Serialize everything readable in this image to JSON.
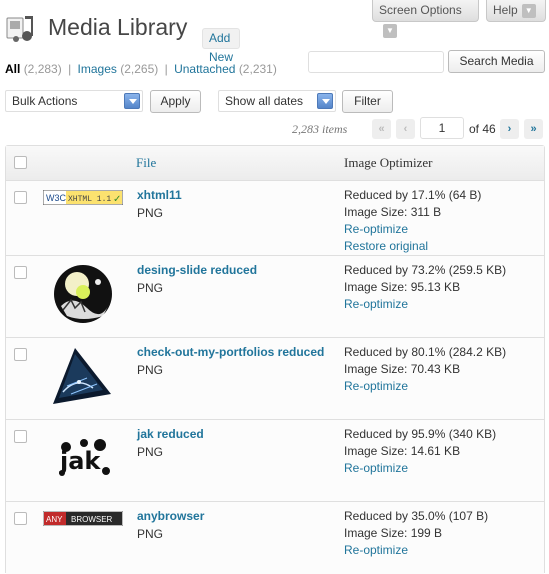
{
  "top_buttons": {
    "screen_options": "Screen Options",
    "help": "Help"
  },
  "header": {
    "title": "Media Library",
    "add_new": "Add New"
  },
  "filters": {
    "all": {
      "label": "All",
      "count": "(2,283)"
    },
    "images": {
      "label": "Images",
      "count": "(2,265)"
    },
    "unattached": {
      "label": "Unattached",
      "count": "(2,231)"
    },
    "separator": "|"
  },
  "search": {
    "value": "",
    "button": "Search Media"
  },
  "bulk": {
    "selected": "Bulk Actions",
    "apply": "Apply"
  },
  "dates": {
    "selected": "Show all dates",
    "filter": "Filter"
  },
  "pagination": {
    "items": "2,283 items",
    "first": "«",
    "prev": "‹",
    "next": "›",
    "last": "»",
    "current": "1",
    "of": "of 46"
  },
  "table": {
    "columns": {
      "file": "File",
      "optimizer": "Image Optimizer"
    },
    "rows": [
      {
        "name": "xhtml11",
        "type": "PNG",
        "thumb": "w3c-xhtml-badge",
        "lines": [
          "Reduced by 17.1% (64 B)",
          "Image Size: 311 B"
        ],
        "links": [
          "Re-optimize",
          "Restore original"
        ]
      },
      {
        "name": "desing-slide reduced",
        "type": "PNG",
        "thumb": "circle-art",
        "lines": [
          "Reduced by 73.2% (259.5 KB)",
          "Image Size: 95.13 KB"
        ],
        "links": [
          "Re-optimize"
        ]
      },
      {
        "name": "check-out-my-portfolios reduced",
        "type": "PNG",
        "thumb": "triangle-art",
        "lines": [
          "Reduced by 80.1% (284.2 KB)",
          "Image Size: 70.43 KB"
        ],
        "links": [
          "Re-optimize"
        ]
      },
      {
        "name": "jak reduced",
        "type": "PNG",
        "thumb": "jak-logo",
        "lines": [
          "Reduced by 95.9% (340 KB)",
          "Image Size: 14.61 KB"
        ],
        "links": [
          "Re-optimize"
        ]
      },
      {
        "name": "anybrowser",
        "type": "PNG",
        "thumb": "any-browser-badge",
        "lines": [
          "Reduced by 35.0% (107 B)",
          "Image Size: 199 B"
        ],
        "links": [
          "Re-optimize"
        ]
      }
    ]
  },
  "badges": {
    "w3c": "W3C",
    "xhtml": "XHTML 1.1",
    "check": "✓",
    "any": "ANY",
    "browser": "BROWSER",
    "jak": "jak"
  },
  "colors": {
    "link": "#21759b",
    "text": "#333333",
    "border": "#dfdfdf"
  }
}
